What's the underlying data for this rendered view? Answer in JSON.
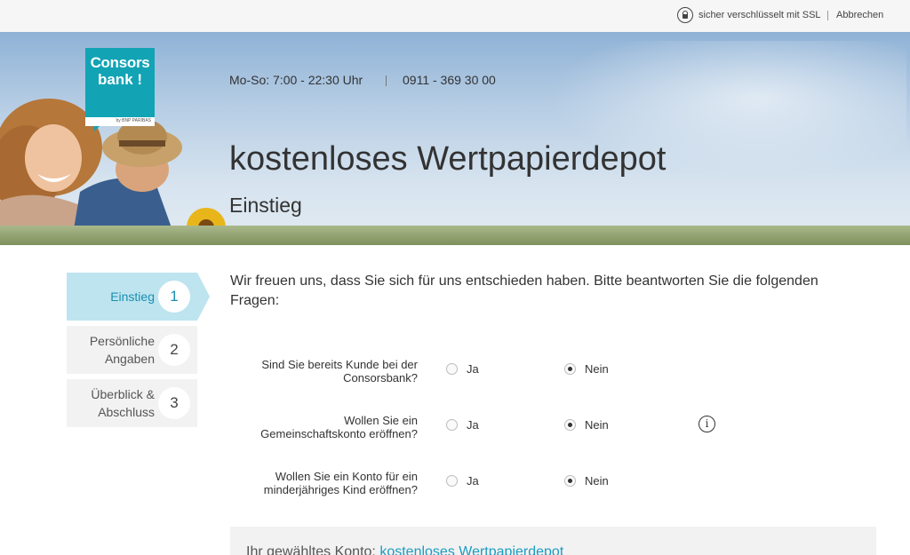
{
  "topbar": {
    "ssl_label": "sicher verschlüsselt mit SSL",
    "cancel_label": "Abbrechen"
  },
  "hero": {
    "logo_line1": "Consors",
    "logo_line2": "bank !",
    "logo_tagline": "by BNP PARIBAS",
    "hours": "Mo-So: 7:00 - 22:30 Uhr",
    "phone": "0911 - 369 30 00",
    "title": "kostenloses Wertpapierdepot",
    "subtitle": "Einstieg"
  },
  "steps": [
    {
      "label_lines": [
        "Einstieg"
      ],
      "number": "1",
      "active": true
    },
    {
      "label_lines": [
        "Persönliche",
        "Angaben"
      ],
      "number": "2",
      "active": false
    },
    {
      "label_lines": [
        "Überblick &",
        "Abschluss"
      ],
      "number": "3",
      "active": false
    }
  ],
  "intro": "Wir freuen uns, dass Sie sich für uns entschieden haben. Bitte beantworten Sie die folgenden Fragen:",
  "questions": [
    {
      "line1": "Sind Sie bereits Kunde bei der",
      "line2": "Consorsbank?",
      "yes": "Ja",
      "no": "Nein",
      "selected": "no"
    },
    {
      "line1": "Wollen Sie ein",
      "line2": "Gemeinschaftskonto eröffnen?",
      "yes": "Ja",
      "no": "Nein",
      "selected": "no"
    },
    {
      "line1": "Wollen Sie ein Konto für ein",
      "line2": "minderjähriges Kind eröffnen?",
      "yes": "Ja",
      "no": "Nein",
      "selected": "no"
    }
  ],
  "summary": {
    "prefix": "Ihr gewähltes Konto:",
    "account": "kostenloses Wertpapierdepot"
  },
  "colors": {
    "brand": "#12a3b5",
    "active_step": "#bde4ef",
    "link": "#1a9cc0"
  },
  "icons": {
    "ssl": "lock-icon",
    "info": "info-icon"
  }
}
